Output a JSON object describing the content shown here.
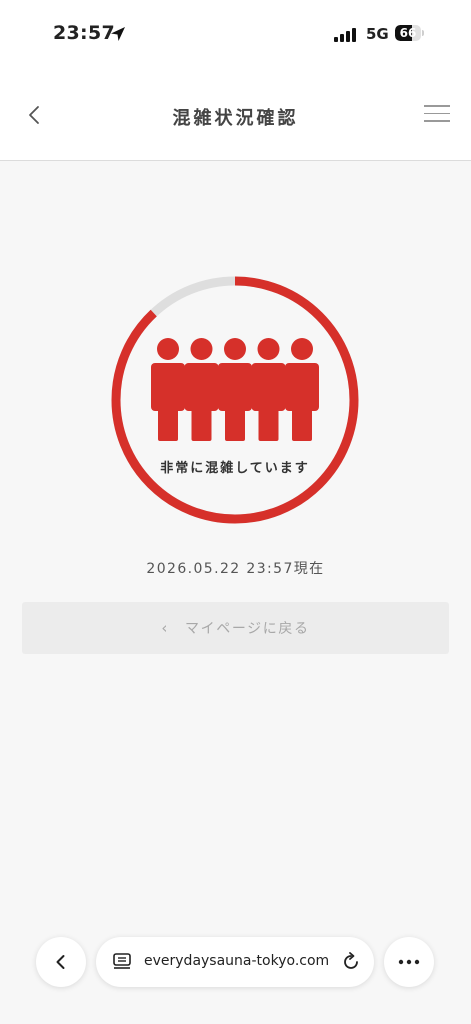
{
  "status_bar": {
    "time": "23:57",
    "network": "5G",
    "battery": "66",
    "battery_level": 0.66
  },
  "header": {
    "title": "混雑状況確認"
  },
  "crowd": {
    "status_text": "非常に混雑しています",
    "fill_fraction": 0.88,
    "people_count": 5,
    "accent_color": "#d6302a"
  },
  "timestamp": "2026.05.22 23:57現在",
  "mypage_button": {
    "label": "マイページに戻る",
    "chevron": "‹"
  },
  "browser": {
    "url": "everydaysauna-tokyo.com"
  }
}
